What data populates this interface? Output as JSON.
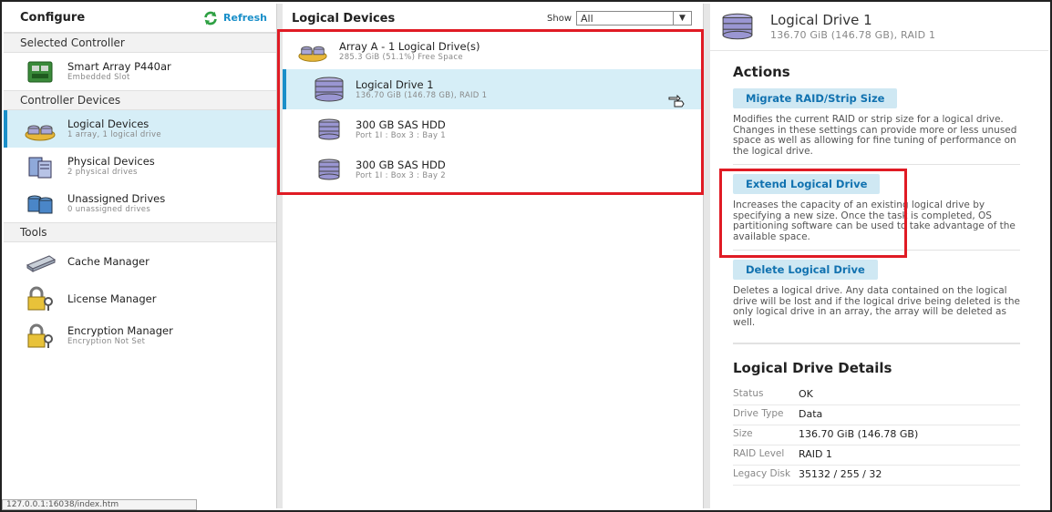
{
  "left": {
    "title": "Configure",
    "refresh_label": "Refresh",
    "sections": {
      "selected_controller": "Selected Controller",
      "controller_devices": "Controller Devices",
      "tools": "Tools"
    },
    "controller": {
      "name": "Smart Array P440ar",
      "sub": "Embedded Slot"
    },
    "devices": [
      {
        "name": "Logical Devices",
        "sub": "1 array, 1 logical drive"
      },
      {
        "name": "Physical Devices",
        "sub": "2 physical drives"
      },
      {
        "name": "Unassigned Drives",
        "sub": "0 unassigned drives"
      }
    ],
    "tools": [
      {
        "name": "Cache Manager",
        "sub": ""
      },
      {
        "name": "License Manager",
        "sub": ""
      },
      {
        "name": "Encryption Manager",
        "sub": "Encryption Not Set"
      }
    ],
    "status_url": "127.0.0.1:16038/index.htm"
  },
  "middle": {
    "title": "Logical Devices",
    "show_label": "Show",
    "show_value": "All",
    "array": {
      "name": "Array A - 1 Logical Drive(s)",
      "sub": "285.3 GiB (51.1%) Free Space"
    },
    "logical_drive": {
      "name": "Logical Drive 1",
      "sub": "136.70 GiB (146.78 GB), RAID 1"
    },
    "drives": [
      {
        "name": "300 GB SAS HDD",
        "sub": "Port 1I : Box 3 : Bay 1"
      },
      {
        "name": "300 GB SAS HDD",
        "sub": "Port 1I : Box 3 : Bay 2"
      }
    ]
  },
  "right": {
    "title": "Logical Drive 1",
    "subtitle": "136.70 GiB (146.78 GB), RAID 1",
    "actions_heading": "Actions",
    "actions": [
      {
        "label": "Migrate RAID/Strip Size",
        "desc": "Modifies the current RAID or strip size for a logical drive. Changes in these settings can provide more or less unused space as well as allowing for fine tuning of performance on the logical drive."
      },
      {
        "label": "Extend Logical Drive",
        "desc": "Increases the capacity of an existing logical drive by specifying a new size. Once the task is completed, OS partitioning software can be used to take advantage of the available space."
      },
      {
        "label": "Delete Logical Drive",
        "desc": "Deletes a logical drive. Any data contained on the logical drive will be lost and if the logical drive being deleted is the only logical drive in an array, the array will be deleted as well."
      }
    ],
    "details_heading": "Logical Drive Details",
    "details": [
      {
        "k": "Status",
        "v": "OK"
      },
      {
        "k": "Drive Type",
        "v": "Data"
      },
      {
        "k": "Size",
        "v": "136.70 GiB (146.78 GB)"
      },
      {
        "k": "RAID Level",
        "v": "RAID 1"
      },
      {
        "k": "Legacy Disk",
        "v": "35132 / 255 / 32"
      }
    ]
  },
  "colors": {
    "accent": "#1a8fc9",
    "selected_bg": "#d6eef7",
    "highlight_red": "#e01b24",
    "button_bg": "#cfe8f3"
  }
}
